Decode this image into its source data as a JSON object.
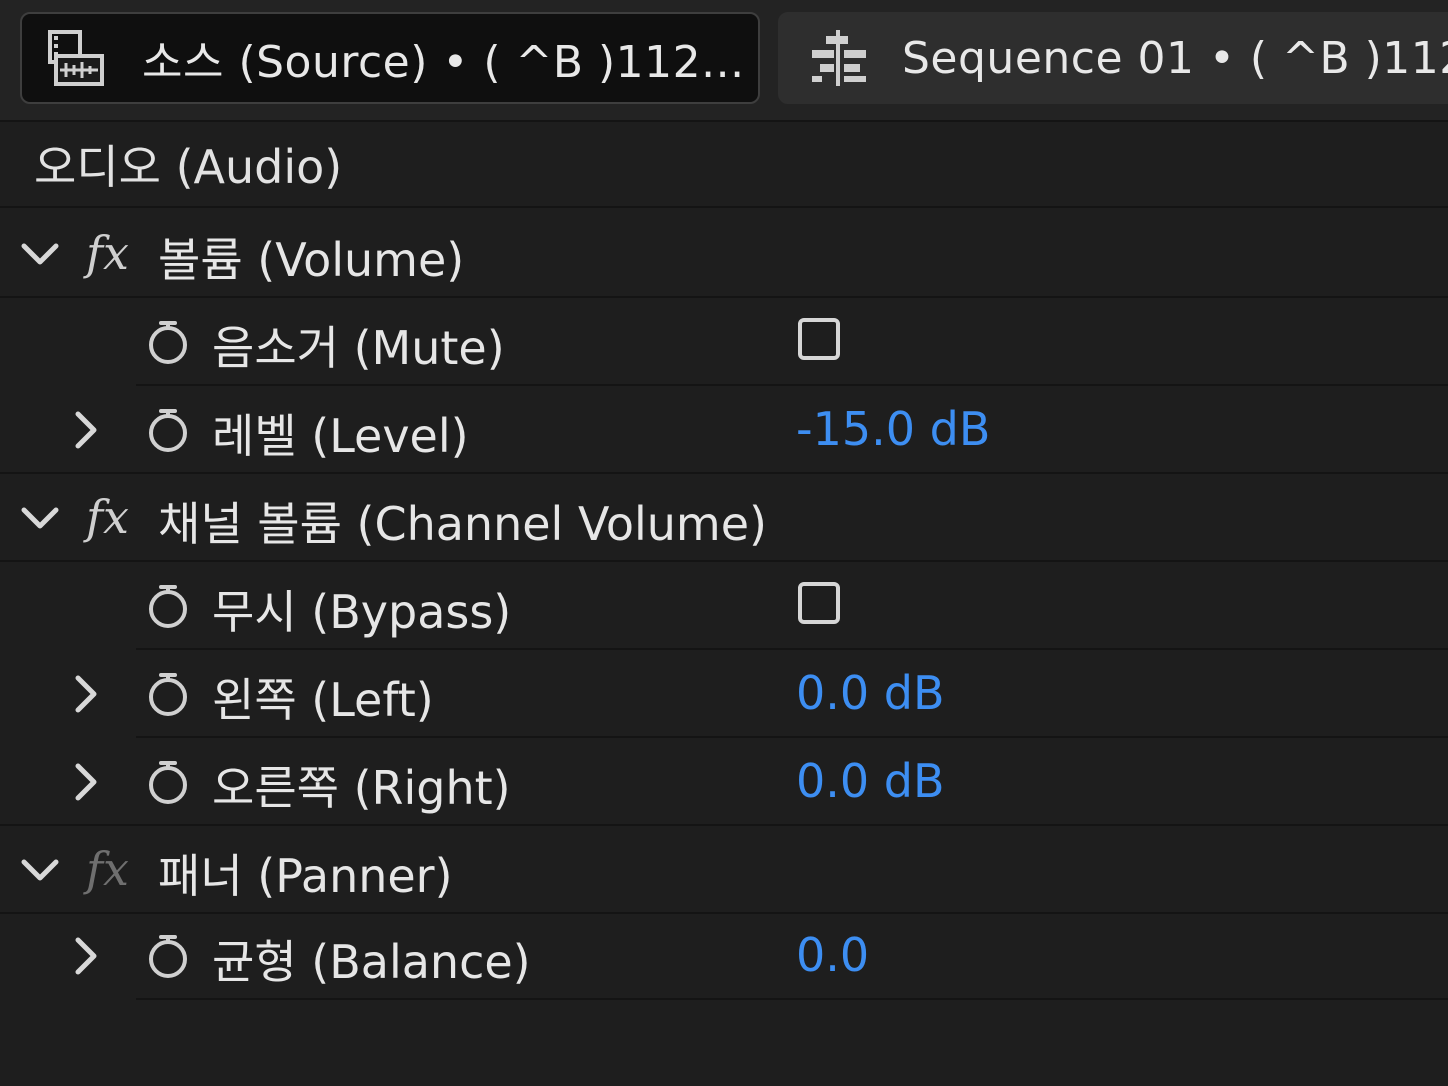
{
  "tabs": [
    {
      "label": "소스 (Source) • ( ^B )112...",
      "icon": "source-clip-icon"
    },
    {
      "label": "Sequence 01 • ( ^B )112...",
      "icon": "sequence-icon"
    }
  ],
  "section": {
    "title": "오디오 (Audio)"
  },
  "effects": {
    "volume": {
      "label": "볼륨 (Volume)",
      "fx": "fx",
      "mute": {
        "label": "음소거 (Mute)",
        "checked": false
      },
      "level": {
        "label": "레벨 (Level)",
        "value": "-15.0 dB"
      }
    },
    "channel_volume": {
      "label": "채널 볼륨 (Channel Volume)",
      "fx": "fx",
      "bypass": {
        "label": "무시 (Bypass)",
        "checked": false
      },
      "left": {
        "label": "왼쪽 (Left)",
        "value": "0.0 dB"
      },
      "right": {
        "label": "오른쪽 (Right)",
        "value": "0.0 dB"
      }
    },
    "panner": {
      "label": "패너 (Panner)",
      "fx": "fx",
      "balance": {
        "label": "균형 (Balance)",
        "value": "0.0"
      }
    }
  },
  "colors": {
    "value_blue": "#3d8ef2",
    "background": "#1e1e1e",
    "text": "#e6e6e6"
  }
}
